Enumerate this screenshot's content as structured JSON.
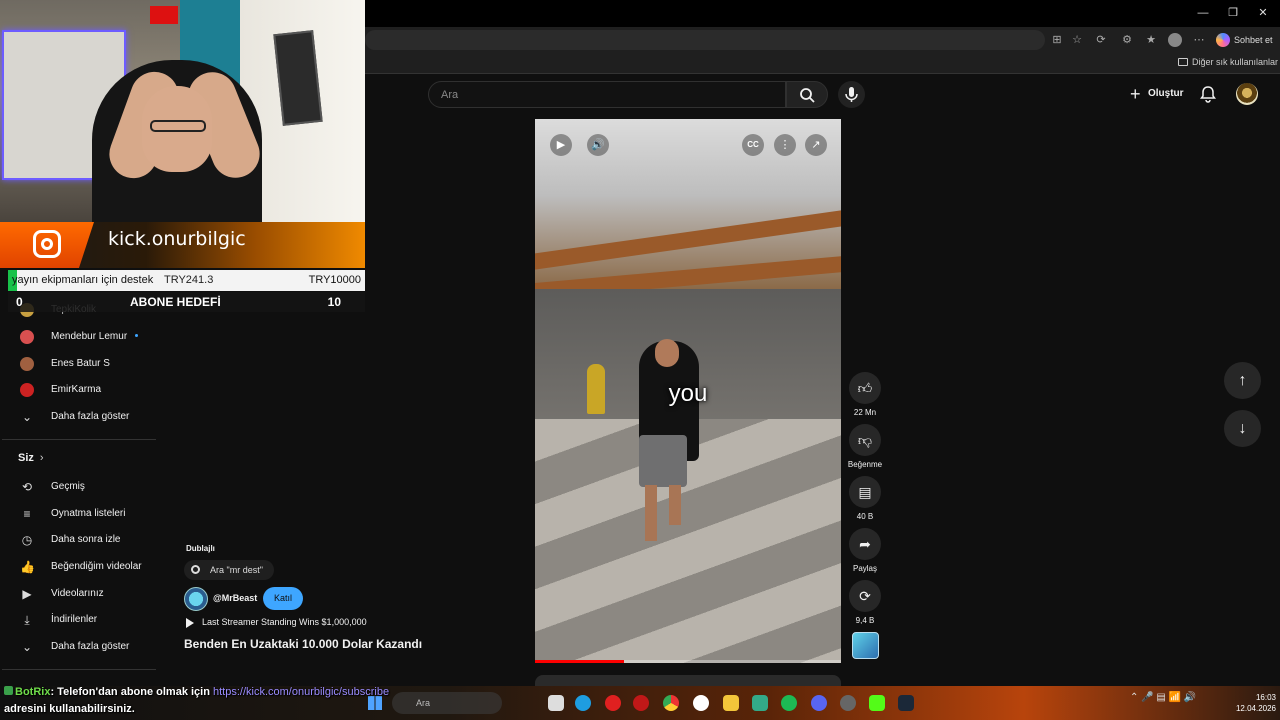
{
  "browser": {
    "copilot_label": "Sohbet et",
    "favorites_label": "Diğer sık kullanılanlar"
  },
  "youtube_header": {
    "search_placeholder": "Ara",
    "create_label": "Oluştur"
  },
  "sidebar": {
    "subscriptions": [
      {
        "label": "TepkiKolik",
        "color": "#c8a040"
      },
      {
        "label": "Mendebur Lemur",
        "color": "#d85050",
        "has_new": true
      },
      {
        "label": "Enes Batur S",
        "color": "#a06040"
      },
      {
        "label": "EmirKarma",
        "color": "#cc2222"
      }
    ],
    "show_more_1": "Daha fazla göster",
    "you_section_title": "Siz",
    "you_items": [
      {
        "label": "Geçmiş",
        "icon": "history-icon"
      },
      {
        "label": "Oynatma listeleri",
        "icon": "playlist-icon"
      },
      {
        "label": "Daha sonra izle",
        "icon": "watch-later-icon"
      },
      {
        "label": "Beğendiğim videolar",
        "icon": "thumbs-up-icon"
      },
      {
        "label": "Videolarınız",
        "icon": "your-videos-icon"
      },
      {
        "label": "İndirilenler",
        "icon": "download-icon"
      }
    ],
    "show_more_2": "Daha fazla göster"
  },
  "stream_overlay": {
    "kick_handle": "kick.onurbilgic",
    "donation_label": "yayın ekipmanları için destek",
    "donation_current": "TRY241.3",
    "donation_goal": "TRY10000",
    "donation_progress_fraction": 0.024,
    "sub_goal_current": "0",
    "sub_goal_label": "ABONE HEDEFİ",
    "sub_goal_target": "10"
  },
  "short": {
    "caption": "you",
    "dubbed_label": "Dublajlı",
    "search_suggestion": "Ara \"mr dest\"",
    "channel_name": "@MrBeast",
    "join_label": "Katıl",
    "related_video": "Last Streamer Standing Wins $1,000,000",
    "title": "Benden En Uzaktaki 10.000 Dolar Kazandı",
    "progress_fraction": 0.29
  },
  "actions": {
    "likes": "22 Mn",
    "dislike_label": "Beğenme",
    "comments": "40 B",
    "share_label": "Paylaş",
    "remix": "9,4 B"
  },
  "chat": {
    "bot_name": "BotRix",
    "message_prefix": ": Telefon'dan abone olmak için ",
    "link": "https://kick.com/onurbilgic/subscribe",
    "message_suffix": "adresini kullanabilirsiniz."
  },
  "taskbar": {
    "search_placeholder": "Ara",
    "time": "16:03",
    "date": "12.04.2026"
  }
}
